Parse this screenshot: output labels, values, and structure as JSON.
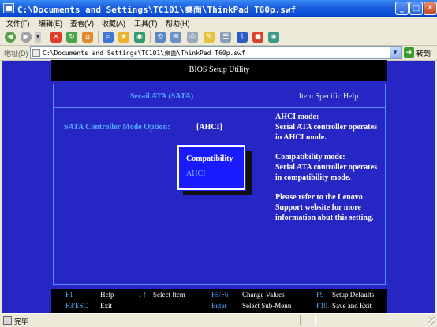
{
  "window": {
    "title": "C:\\Documents and Settings\\TC101\\桌面\\ThinkPad T60p.swf",
    "buttons": [
      "minimize",
      "maximize",
      "close"
    ]
  },
  "menu": [
    "文件(F)",
    "编辑(E)",
    "查看(V)",
    "收藏(A)",
    "工具(T)",
    "帮助(H)"
  ],
  "toolbar": {
    "icons": [
      "back-icon",
      "forward-icon",
      "stop-icon",
      "refresh-icon",
      "home-icon",
      "search-icon",
      "favorites-icon",
      "media-icon",
      "history-icon",
      "mail-icon",
      "print-icon",
      "edit-icon",
      "discuss-icon",
      "messenger-icon",
      "bluetooth-icon",
      "research-icon",
      "settings-icon"
    ]
  },
  "address": {
    "label": "地址(D)",
    "value": "C:\\Documents and Settings\\TC101\\桌面\\ThinkPad T60p.swf",
    "go_label": "转到"
  },
  "bios": {
    "header": "BIOS Setup Utility",
    "tab": "Serail ATA (SATA)",
    "help_heading": "Item Specific Help",
    "option_label": "SATA Controller Mode Option:",
    "option_value": "[AHCI]",
    "popup": {
      "options": [
        "Compatibility",
        "AHCI"
      ],
      "highlighted": "Compatibility"
    },
    "help": [
      "AHCI mode:",
      "Serial ATA controller operates in AHCI mode.",
      "Compatibility mode:",
      "Serial ATA controller operates in compatibility mode.",
      "Please refer to the Lenovo Support website for more information abut this setting."
    ],
    "legend": {
      "f1_key": "F1",
      "f1_desc": "Help",
      "arrows_key": "↓↑",
      "arrows_desc": "Select Item",
      "f5f6_key": "F5/F6",
      "f5f6_desc": "Change Values",
      "f9_key": "F9",
      "f9_desc": "Setup Defaults",
      "esc_key": "F3/ESC",
      "esc_desc": "Exit",
      "enter_key": "Enter",
      "enter_desc": "Select Sub-Menu",
      "f10_key": "F10",
      "f10_desc": "Save and Exit"
    }
  },
  "colors": {
    "bios_background": "#2626C4",
    "bios_accent": "#55AAFF",
    "popup_background": "#1A1AFF"
  },
  "status": {
    "text": "完毕"
  }
}
